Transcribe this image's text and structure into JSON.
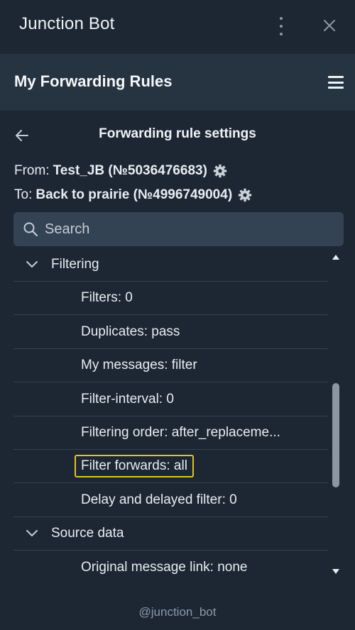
{
  "window": {
    "title": "Junction Bot"
  },
  "header": {
    "title": "My Forwarding Rules"
  },
  "section": {
    "title": "Forwarding rule settings"
  },
  "route": {
    "from_label": "From:",
    "from_value": "Test_JB (№5036476683)",
    "to_label": "To:",
    "to_value": "Back to prairie (№4996749004)"
  },
  "search": {
    "placeholder": "Search",
    "value": ""
  },
  "list": {
    "filtering_group": "Filtering",
    "filters": "Filters: 0",
    "duplicates": "Duplicates: pass",
    "my_messages": "My messages: filter",
    "filter_interval": "Filter-interval: 0",
    "filtering_order": "Filtering order: after_replaceme...",
    "filter_forwards": "Filter forwards: all",
    "delay": "Delay and delayed filter: 0",
    "source_group": "Source data",
    "original_link": "Original message link: none"
  },
  "footer": {
    "handle": "@junction_bot"
  },
  "icons": {
    "more": "kebab-icon",
    "close": "close-icon",
    "menu": "hamburger-icon",
    "back": "back-arrow-icon",
    "settings": "gear-icon",
    "search": "search-icon",
    "expand": "chevron-down-icon"
  },
  "colors": {
    "background": "#1c2733",
    "header": "#263341",
    "search_bg": "#344353",
    "highlight": "#e3c324",
    "muted": "#8b98a6"
  }
}
